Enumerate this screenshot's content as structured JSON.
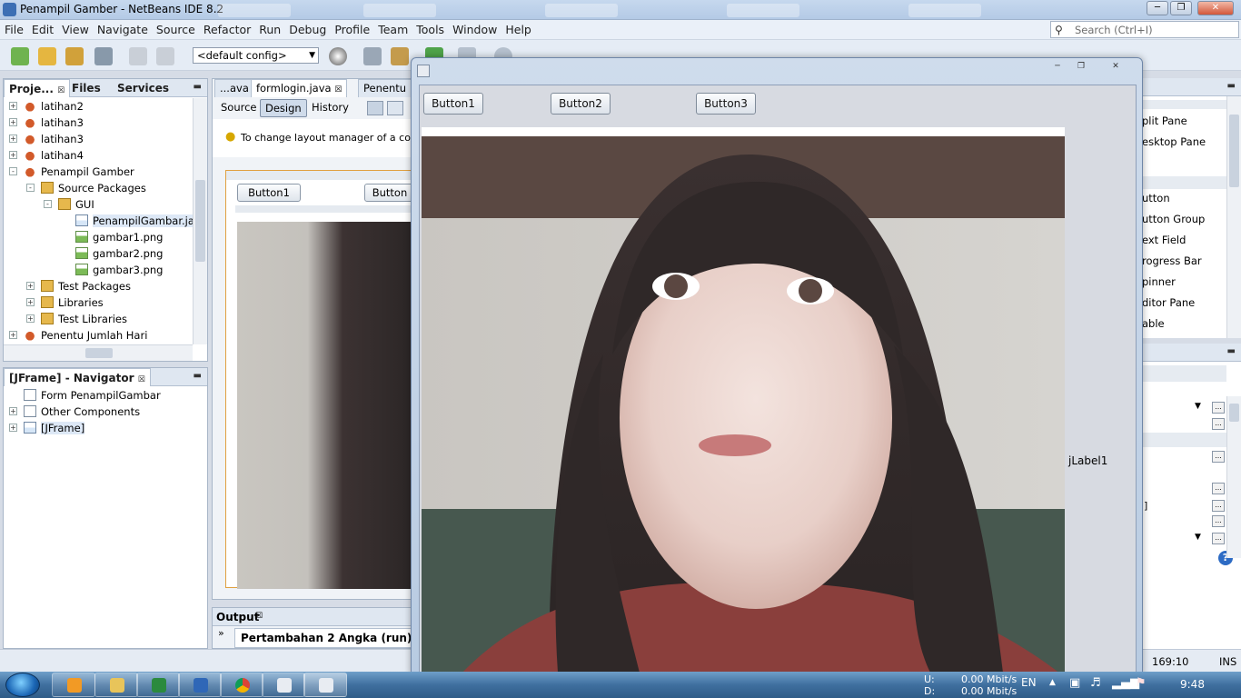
{
  "window": {
    "title": "Penampil Gamber - NetBeans IDE 8.2",
    "controls": [
      "minimize",
      "maximize",
      "close"
    ]
  },
  "menu": [
    "File",
    "Edit",
    "View",
    "Navigate",
    "Source",
    "Refactor",
    "Run",
    "Debug",
    "Profile",
    "Team",
    "Tools",
    "Window",
    "Help"
  ],
  "search": {
    "placeholder": "Search (Ctrl+I)"
  },
  "toolbar": {
    "config": "<default config>"
  },
  "projects_panel": {
    "tabs": [
      "Proje...",
      "Files",
      "Services"
    ],
    "tree": [
      {
        "label": "latihan2",
        "icon": "project-icon",
        "level": 0,
        "exp": "+"
      },
      {
        "label": "latihan3",
        "icon": "project-icon",
        "level": 0,
        "exp": "+"
      },
      {
        "label": "latihan3",
        "icon": "project-icon",
        "level": 0,
        "exp": "+"
      },
      {
        "label": "latihan4",
        "icon": "project-icon",
        "level": 0,
        "exp": "+"
      },
      {
        "label": "Penampil Gamber",
        "icon": "project-icon",
        "level": 0,
        "exp": "-"
      },
      {
        "label": "Source Packages",
        "icon": "package-folder-icon",
        "level": 1,
        "exp": "-"
      },
      {
        "label": "GUI",
        "icon": "package-icon",
        "level": 2,
        "exp": "-"
      },
      {
        "label": "PenampilGambar.java",
        "icon": "java-form-icon",
        "level": 3,
        "exp": "",
        "selected": true
      },
      {
        "label": "gambar1.png",
        "icon": "png-file-icon",
        "level": 3,
        "exp": ""
      },
      {
        "label": "gambar2.png",
        "icon": "png-file-icon",
        "level": 3,
        "exp": ""
      },
      {
        "label": "gambar3.png",
        "icon": "png-file-icon",
        "level": 3,
        "exp": ""
      },
      {
        "label": "Test Packages",
        "icon": "package-folder-icon",
        "level": 1,
        "exp": "+"
      },
      {
        "label": "Libraries",
        "icon": "library-icon",
        "level": 1,
        "exp": "+"
      },
      {
        "label": "Test Libraries",
        "icon": "library-icon",
        "level": 1,
        "exp": "+"
      },
      {
        "label": "Penentu Jumlah Hari",
        "icon": "project-icon",
        "level": 0,
        "exp": "+"
      }
    ]
  },
  "navigator_panel": {
    "title": "[JFrame] - Navigator",
    "tree": [
      {
        "label": "Form PenampilGambar",
        "icon": "form-icon",
        "level": 0,
        "exp": ""
      },
      {
        "label": "Other Components",
        "icon": "components-icon",
        "level": 0,
        "exp": "+"
      },
      {
        "label": "[JFrame]",
        "icon": "jframe-icon",
        "level": 0,
        "exp": "+",
        "selected": true
      }
    ]
  },
  "editor": {
    "tabs": [
      "...ava",
      "formlogin.java",
      "Penentu"
    ],
    "view_buttons": [
      "Source",
      "Design",
      "History"
    ],
    "active_view": "Design",
    "hint": "To change layout manager of a contai",
    "form_buttons": [
      "Button1",
      "Button"
    ]
  },
  "output": {
    "title": "Output",
    "run_tab": "Pertambahan 2 Angka (run)",
    "expand": "»"
  },
  "palette": {
    "items": [
      "plit Pane",
      "esktop Pane",
      "utton",
      "utton Group",
      "ext Field",
      "rogress Bar",
      "pinner",
      "ditor Pane",
      "able"
    ]
  },
  "properties": {
    "help_icon": "?",
    "row_text": "]"
  },
  "status": {
    "position": "169:10",
    "mode": "INS"
  },
  "running_app": {
    "buttons": [
      "Button1",
      "Button2",
      "Button3"
    ],
    "label": "jLabel1"
  },
  "taskbar": {
    "network_up_label": "U:",
    "network_up": "0.00 Mbit/s",
    "network_down_label": "D:",
    "network_down": "0.00 Mbit/s",
    "language": "EN",
    "time": "9:48"
  }
}
